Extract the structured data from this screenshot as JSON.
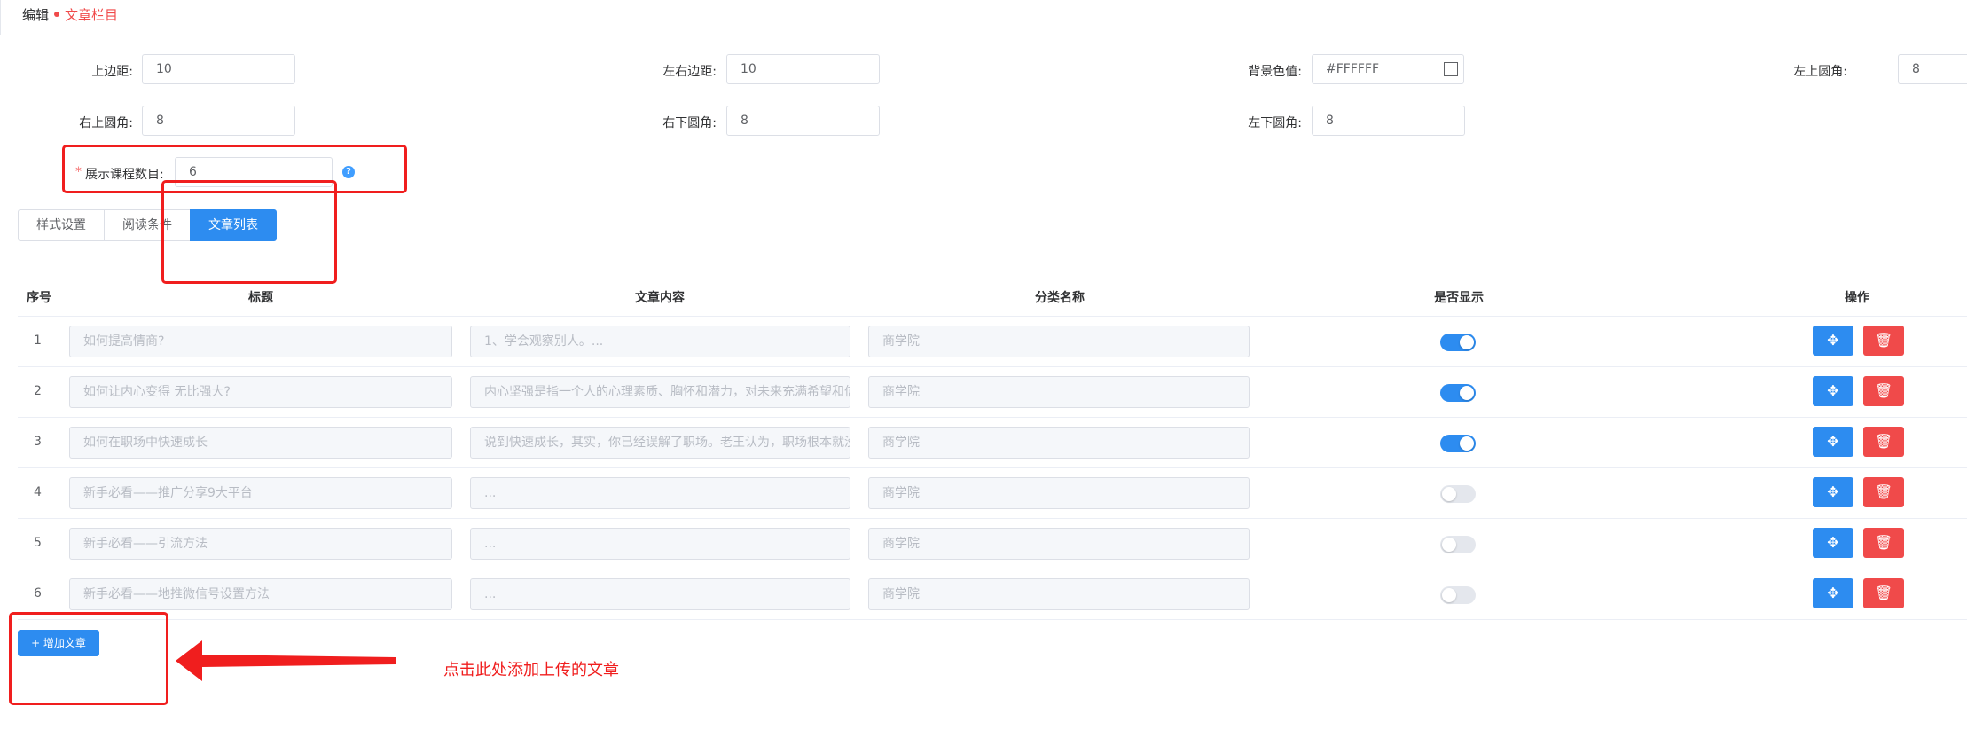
{
  "breadcrumb": {
    "edit": "编辑",
    "current": "文章栏目"
  },
  "form": {
    "top_margin": {
      "label": "上边距:",
      "value": "10"
    },
    "lr_margin": {
      "label": "左右边距:",
      "value": "10"
    },
    "bg_color": {
      "label": "背景色值:",
      "value": "#FFFFFF"
    },
    "tl_radius": {
      "label": "左上圆角:",
      "value": "8"
    },
    "tr_radius": {
      "label": "右上圆角:",
      "value": "8"
    },
    "br_radius": {
      "label": "右下圆角:",
      "value": "8"
    },
    "bl_radius": {
      "label": "左下圆角:",
      "value": "8"
    },
    "course_count": {
      "required_mark": "*",
      "label": "展示课程数目:",
      "value": "6",
      "help": "?"
    }
  },
  "tabs": [
    "样式设置",
    "阅读条件",
    "文章列表"
  ],
  "active_tab": "文章列表",
  "table": {
    "headers": {
      "index": "序号",
      "title": "标题",
      "content": "文章内容",
      "category": "分类名称",
      "visible": "是否显示",
      "actions": "操作"
    },
    "rows": [
      {
        "index": "1",
        "title": "如何提高情商?",
        "content": "1、学会观察别人。...",
        "category": "商学院",
        "visible": true
      },
      {
        "index": "2",
        "title": "如何让内心变得 无比强大?",
        "content": "内心坚强是指一个人的心理素质、胸怀和潜力，对未来充满希望和信心",
        "category": "商学院",
        "visible": true
      },
      {
        "index": "3",
        "title": "如何在职场中快速成长",
        "content": "说到快速成长，其实，你已经误解了职场。老王认为，职场根本就没有",
        "category": "商学院",
        "visible": true
      },
      {
        "index": "4",
        "title": "新手必看——推广分享9大平台",
        "content": "...",
        "category": "商学院",
        "visible": false
      },
      {
        "index": "5",
        "title": "新手必看——引流方法",
        "content": "...",
        "category": "商学院",
        "visible": false
      },
      {
        "index": "6",
        "title": "新手必看——地推微信号设置方法",
        "content": "...",
        "category": "商学院",
        "visible": false
      }
    ]
  },
  "add_button": "+ 增加文章",
  "annotation_note": "点击此处添加上传的文章",
  "colors": {
    "primary": "#2d8cf0",
    "danger": "#f04a4a",
    "annotation": "#f01e1e"
  }
}
